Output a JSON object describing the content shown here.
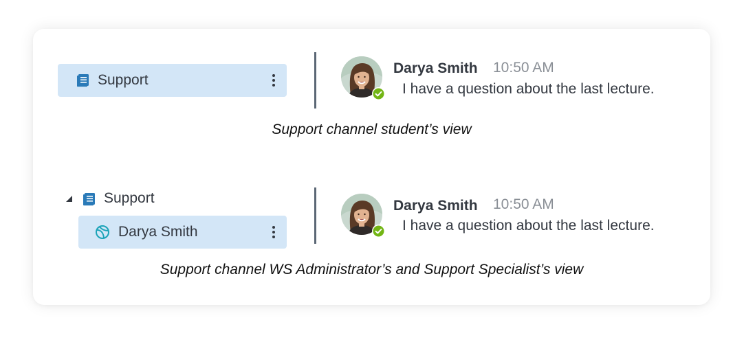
{
  "colors": {
    "selected_bg": "#d3e6f7",
    "channel_icon": "#2a7ab8",
    "user_icon": "#1ba3b8",
    "online_status": "#72b514",
    "divider": "#5b6775",
    "time_text": "#8a8f96"
  },
  "student_view": {
    "channel": {
      "icon": "book-icon",
      "label": "Support",
      "menu_icon": "more-vertical-icon"
    },
    "message": {
      "author": "Darya Smith",
      "time": "10:50 AM",
      "text": "I have a question about the last lecture.",
      "status": "online"
    },
    "caption": "Support channel student’s view"
  },
  "admin_view": {
    "channel": {
      "expand_icon": "collapse-triangle-icon",
      "icon": "book-icon",
      "label": "Support"
    },
    "sub_channel": {
      "icon": "globe-user-icon",
      "label": "Darya Smith",
      "menu_icon": "more-vertical-icon"
    },
    "message": {
      "author": "Darya Smith",
      "time": "10:50 AM",
      "text": "I have a question about the last lecture.",
      "status": "online"
    },
    "caption": "Support channel WS Administrator’s and Support Specialist’s view"
  }
}
